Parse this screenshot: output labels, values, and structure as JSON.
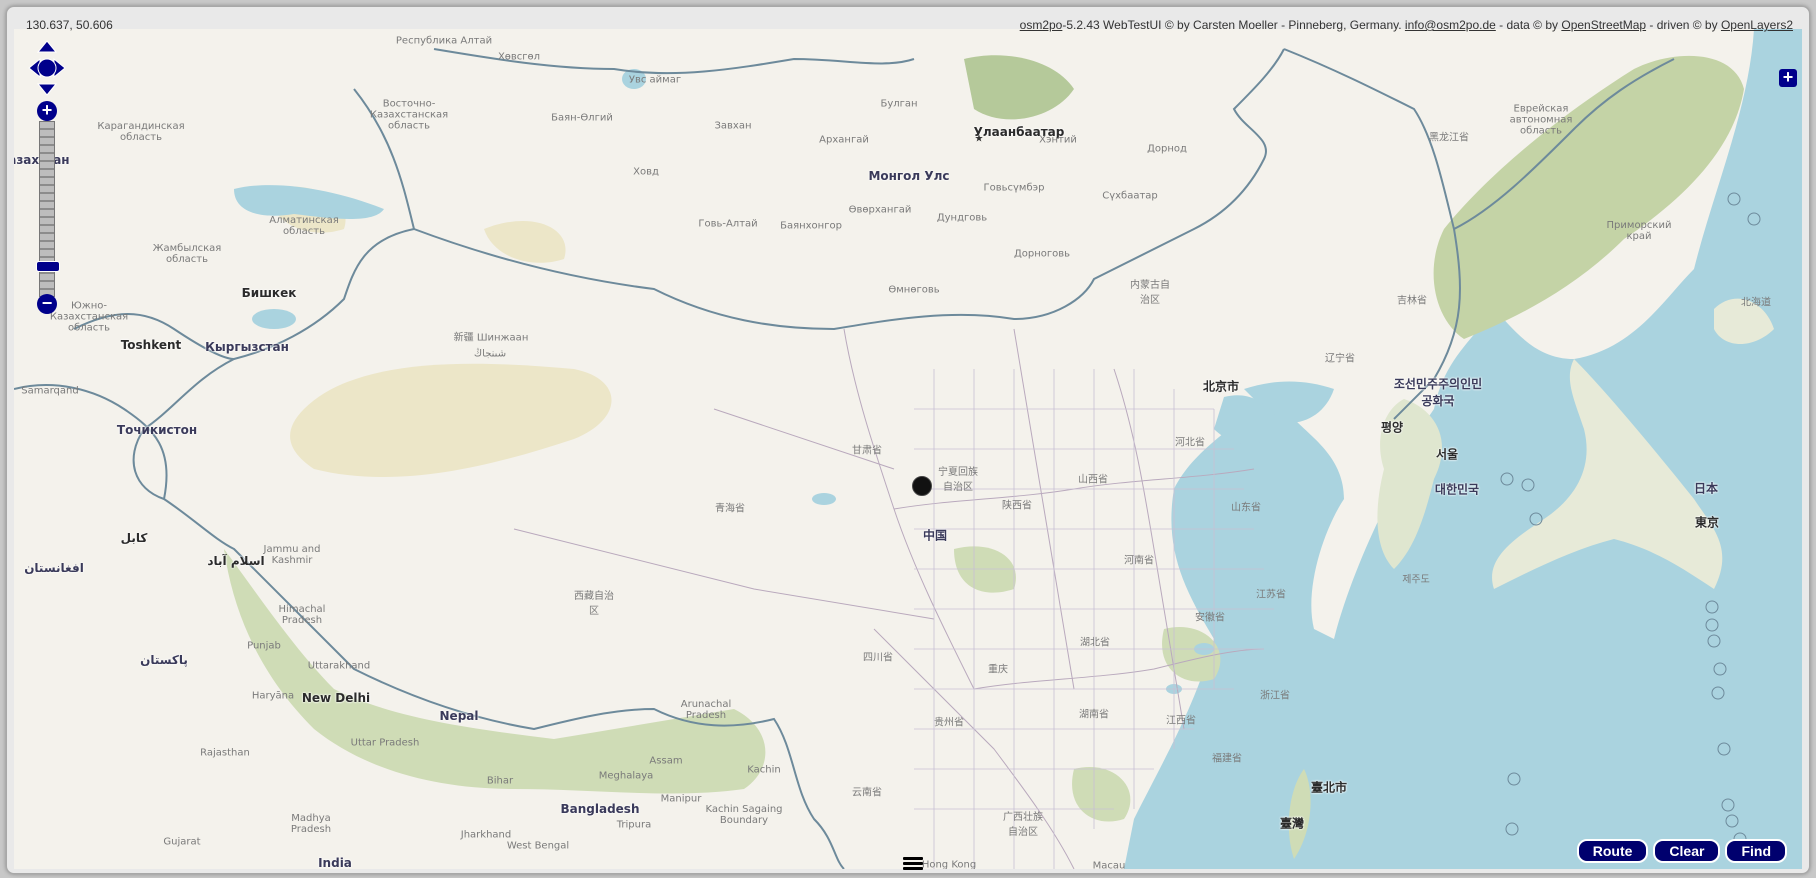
{
  "header": {
    "coords": "130.637, 50.606",
    "attribution": {
      "app": "osm2po",
      "text1": "-5.2.43 WebTestUI © by Carsten Moeller - Pinneberg, Germany. ",
      "email": "info@osm2po.de",
      "text2": " - data © by ",
      "osm": "OpenStreetMap",
      "text3": " - driven © by ",
      "ol": "OpenLayers2"
    }
  },
  "controls": {
    "zoom_in": "+",
    "zoom_out": "−",
    "layer_switcher": "+",
    "route": "Route",
    "clear": "Clear",
    "find": "Find"
  },
  "colors": {
    "land": "#f4f2ec",
    "water": "#aad3df",
    "forest": "#b5c99a",
    "desert": "#ece6c8",
    "border": "#6d8a9b",
    "control": "#00008b"
  },
  "labels": {
    "l01": "Республика Алтай",
    "l02": "Хөвсгөл",
    "l03": "Увс аймаг",
    "l04": "Баян-Өлгий",
    "l05": "Завхан",
    "l06": "Архангай",
    "l07": "Булган",
    "l08": "Улаанбаатар",
    "l09": "Хэнтий",
    "l10": "Дорнод",
    "l11": "Монгол Улс",
    "l12": "Ховд",
    "l13": "Говь-Алтай",
    "l14": "Баянхонгор",
    "l15": "Өвөрхангай",
    "l16": "Говьсүмбэр",
    "l17": "Дундговь",
    "l18": "Сүхбаатар",
    "l19": "Дорноговь",
    "l20": "Өмнөговь",
    "l21": "Восточно-Казахстанская область",
    "l22": "Карагандинская область",
    "l23": "Алматинская область",
    "l24": "Жамбылская область",
    "l25": "Бишкек",
    "l26": "Кыргызстан",
    "l27": "Toshkent",
    "l28": "Точикистон",
    "l29": "Казахстан",
    "l30": "Южно-Казахстанская область",
    "l31": "Samarqand",
    "l32": "كابل",
    "l33": "افغانستان",
    "l34": "اسلام آباد",
    "l35": "پاکستان",
    "l36": "Jammu and Kashmir",
    "l37": "Himachal Pradesh",
    "l38": "Punjab",
    "l39": "Uttarakhand",
    "l40": "Haryāna",
    "l41": "New Delhi",
    "l42": "Nepal",
    "l43": "Uttar Pradesh",
    "l44": "Rajasthan",
    "l45": "Bihar",
    "l46": "Madhya Pradesh",
    "l47": "Jharkhand",
    "l48": "West Bengal",
    "l49": "Gujarat",
    "l50": "India",
    "l51": "Bangladesh",
    "l52": "Meghalaya",
    "l53": "Assam",
    "l54": "Arunachal Pradesh",
    "l55": "Kachin",
    "l56": "Kachin Sagaing Boundary",
    "l57": "Tripura",
    "l58": "Manipur",
    "l59": "新疆 Шинжаан",
    "l60": "شىنجاڭ",
    "l61": "甘肃省",
    "l62": "青海省",
    "l63": "宁夏回族自治区",
    "l64": "中国",
    "l65": "西藏自治区",
    "l66": "四川省",
    "l67": "重庆",
    "l68": "陕西省",
    "l69": "山西省",
    "l70": "河南省",
    "l71": "湖北省",
    "l72": "湖南省",
    "l73": "贵州省",
    "l74": "云南省",
    "l75": "广西壮族自治区",
    "l76": "江西省",
    "l77": "福建省",
    "l78": "浙江省",
    "l79": "安徽省",
    "l80": "江苏省",
    "l81": "山东省",
    "l82": "河北省",
    "l83": "北京市",
    "l84": "内蒙古自治区",
    "l85": "辽宁省",
    "l86": "吉林省",
    "l87": "黑龙江省",
    "l88": "Еврейская автономная область",
    "l89": "Приморский край",
    "l90": "조선민주주의인민공화국",
    "l91": "평양",
    "l92": "서울",
    "l93": "대한민국",
    "l94": "제주도",
    "l95": "日本",
    "l96": "東京",
    "l97": "北海道",
    "l98": "臺北市",
    "l99": "臺灣",
    "l100": "Macau",
    "l101": "Hong Kong"
  }
}
